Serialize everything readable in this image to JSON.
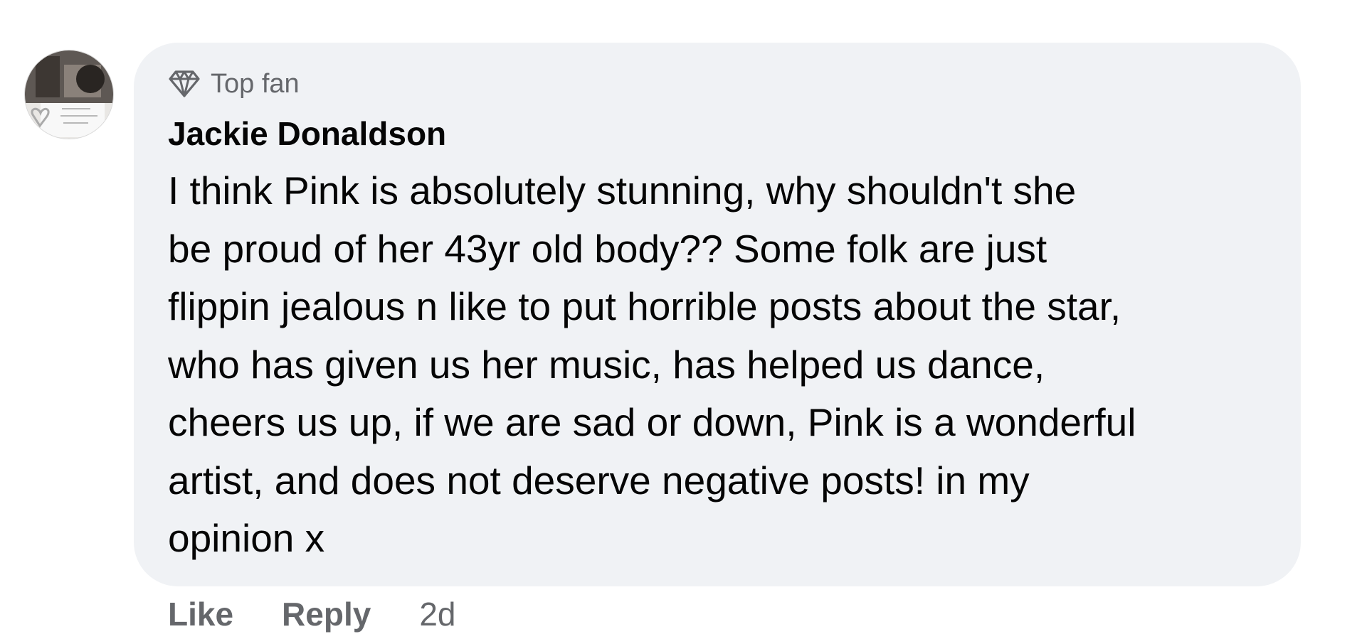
{
  "comment": {
    "avatar_alt": "profile picture",
    "badge": {
      "icon": "diamond-icon",
      "label": "Top fan"
    },
    "author": "Jackie Donaldson",
    "text_lines": [
      "I think Pink is absolutely stunning, why shouldn't she",
      "be proud of her 43yr old body?? Some folk are just",
      "flippin jealous n like to put horrible posts about the star,",
      "who has given us her music, has helped us dance,",
      "cheers us up, if we are sad or down, Pink is a wonderful",
      "artist, and does not deserve negative posts! in my",
      "opinion x"
    ],
    "actions": {
      "like": "Like",
      "reply": "Reply",
      "timestamp": "2d"
    }
  },
  "colors": {
    "bubble_bg": "#f0f2f5",
    "primary_text": "#050505",
    "secondary_text": "#65676b"
  }
}
